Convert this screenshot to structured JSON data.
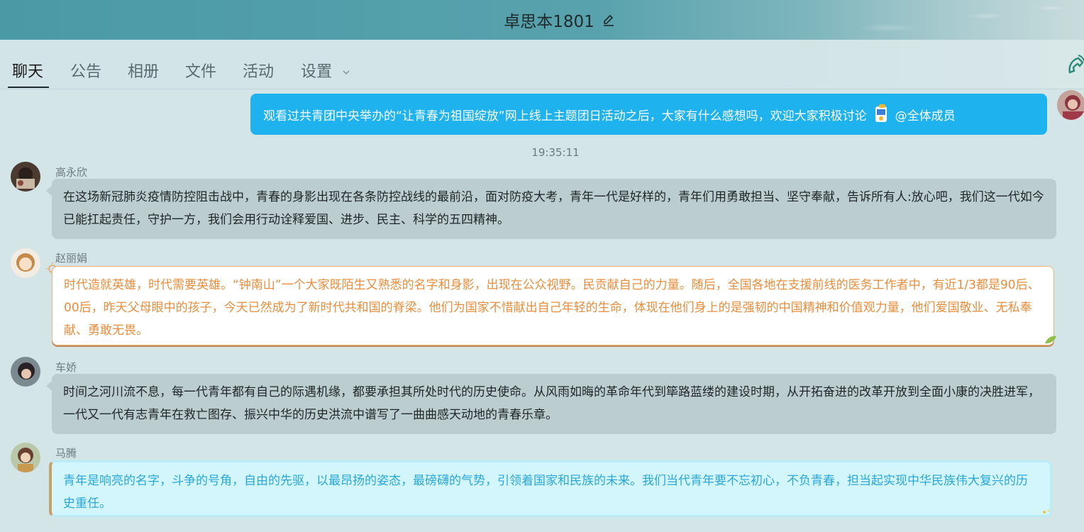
{
  "window": {
    "title": "卓思本1801"
  },
  "tabs": [
    {
      "label": "聊天"
    },
    {
      "label": "公告"
    },
    {
      "label": "相册"
    },
    {
      "label": "文件"
    },
    {
      "label": "活动"
    },
    {
      "label": "设置"
    }
  ],
  "self_message": {
    "text": "观看过共青团中央举办的“让青春为祖国绽放”网上线上主题团日活动之后，大家有什么感想吗，欢迎大家积极讨论",
    "mention": "@全体成员"
  },
  "timestamp": "19:35:11",
  "messages": [
    {
      "sender": "高永欣",
      "text": "在这场新冠肺炎疫情防控阻击战中，青春的身影出现在各条防控战线的最前沿，面对防疫大考，青年一代是好样的，青年们用勇敢担当、坚守奉献，告诉所有人:放心吧，我们这一代如今已能扛起责任，守护一方，我们会用行动诠释爱国、进步、民主、科学的五四精神。"
    },
    {
      "sender": "赵丽娟",
      "text": "时代造就英雄，时代需要英雄。“钟南山”一个大家既陌生又熟悉的名字和身影，出现在公众视野。民贡献自己的力量。随后，全国各地在支援前线的医务工作者中，有近1/3都是90后、00后，昨天父母眼中的孩子，今天已然成为了新时代共和国的脊梁。他们为国家不惜献出自己年轻的生命，体现在他们身上的是强韧的中国精神和价值观力量，他们爱国敬业、无私奉献、勇敢无畏。"
    },
    {
      "sender": "车娇",
      "text": "时间之河川流不息，每一代青年都有自己的际遇机缘，都要承担其所处时代的历史使命。从风雨如晦的革命年代到筚路蓝缕的建设时期，从开拓奋进的改革开放到全面小康的决胜进军，一代又一代有志青年在救亡图存、振兴中华的历史洪流中谱写了一曲曲感天动地的青春乐章。"
    },
    {
      "sender": "马腾",
      "text": "青年是响亮的名字，斗争的号角，自由的先驱，以最昂扬的姿态，最磅礴的气势，引领着国家和民族的未来。我们当代青年要不忘初心，不负青春，担当起实现中华民族伟大复兴的历史重任。"
    }
  ],
  "colors": {
    "self_bubble": "#1eb3ee",
    "gray_bubble": "#bccdd0",
    "orange_text": "#e88d3c",
    "cyan_text": "#2aa7d5"
  }
}
